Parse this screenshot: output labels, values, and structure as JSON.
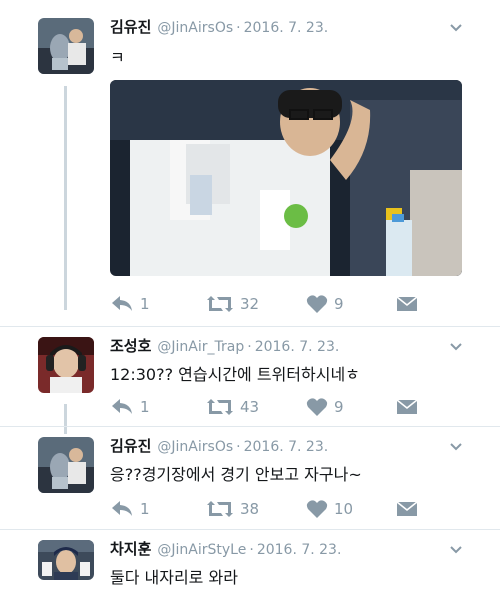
{
  "tweets": [
    {
      "name": "김유진",
      "handle": "@JinAirsOs",
      "sep": "·",
      "date": "2016. 7. 23.",
      "text": "ㅋ",
      "reply_count": "1",
      "retweet_count": "32",
      "like_count": "9"
    },
    {
      "name": "조성호",
      "handle": "@JinAir_Trap",
      "sep": "·",
      "date": "2016. 7. 23.",
      "text": "12:30?? 연습시간에 트위터하시네ㅎ",
      "reply_count": "1",
      "retweet_count": "43",
      "like_count": "9"
    },
    {
      "name": "김유진",
      "handle": "@JinAirsOs",
      "sep": "·",
      "date": "2016. 7. 23.",
      "text": "응??경기장에서 경기 안보고 자구나~",
      "reply_count": "1",
      "retweet_count": "38",
      "like_count": "10"
    },
    {
      "name": "차지훈",
      "handle": "@JinAirStyLe",
      "sep": "·",
      "date": "2016. 7. 23.",
      "text": "둘다 내자리로 와라"
    }
  ],
  "colors": {
    "muted": "#8899a6",
    "thread_line": "#ccd6dd",
    "divider": "#e1e8ed"
  },
  "icons": [
    "reply-icon",
    "retweet-icon",
    "like-icon",
    "dm-icon",
    "chevron-down-icon"
  ]
}
